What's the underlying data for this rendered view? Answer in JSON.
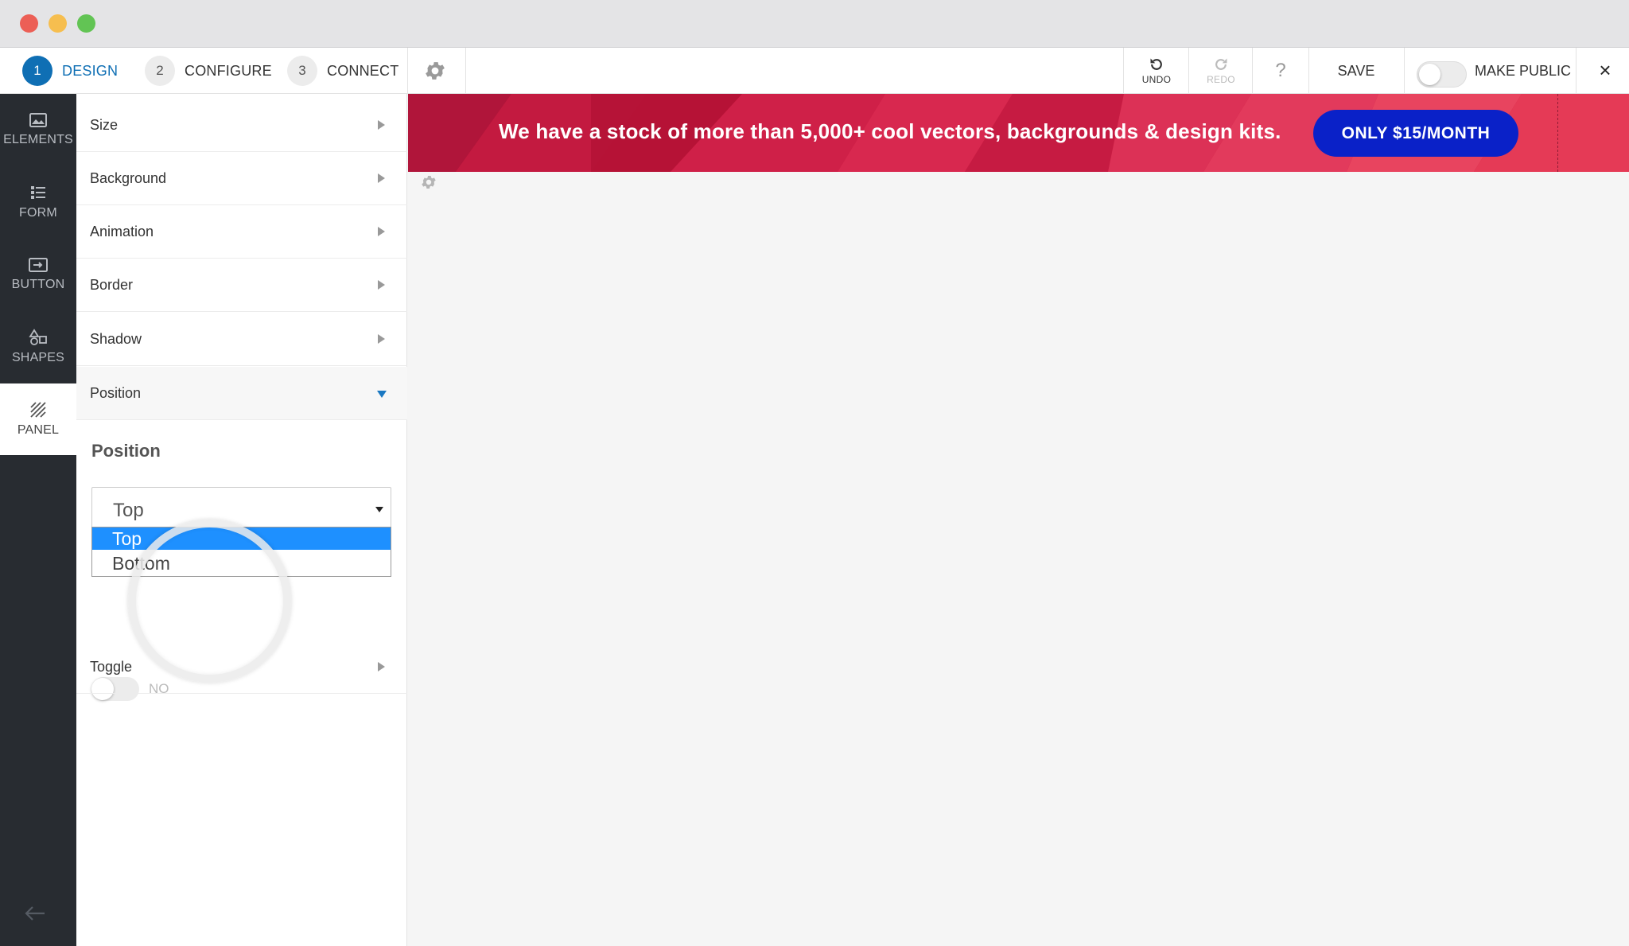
{
  "toolbar": {
    "steps": [
      {
        "num": "1",
        "label": "DESIGN"
      },
      {
        "num": "2",
        "label": "CONFIGURE"
      },
      {
        "num": "3",
        "label": "CONNECT"
      }
    ],
    "undo_label": "UNDO",
    "redo_label": "REDO",
    "help_label": "?",
    "save_label": "SAVE",
    "make_public_label": "MAKE PUBLIC",
    "close_label": "×"
  },
  "leftnav": {
    "items": [
      {
        "label": "ELEMENTS",
        "icon": "image-icon"
      },
      {
        "label": "FORM",
        "icon": "list-icon"
      },
      {
        "label": "BUTTON",
        "icon": "button-icon"
      },
      {
        "label": "SHAPES",
        "icon": "shapes-icon"
      },
      {
        "label": "PANEL",
        "icon": "panel-icon"
      }
    ]
  },
  "panel": {
    "sections": [
      "Size",
      "Background",
      "Animation",
      "Border",
      "Shadow",
      "Position"
    ],
    "toggle_section": "Toggle",
    "position_heading": "Position",
    "select_value": "Top",
    "options": [
      "Top",
      "Bottom"
    ],
    "toggle_state": "NO"
  },
  "banner": {
    "text": "We have a stock of more than 5,000+ cool vectors, backgrounds & design kits.",
    "cta": "ONLY $15/MONTH"
  },
  "colors": {
    "accent": "#0f6fb4",
    "banner_red": "#c4183c",
    "cta_blue": "#0a21c8",
    "nav_dark": "#282c31",
    "option_highlight": "#1e90ff"
  }
}
